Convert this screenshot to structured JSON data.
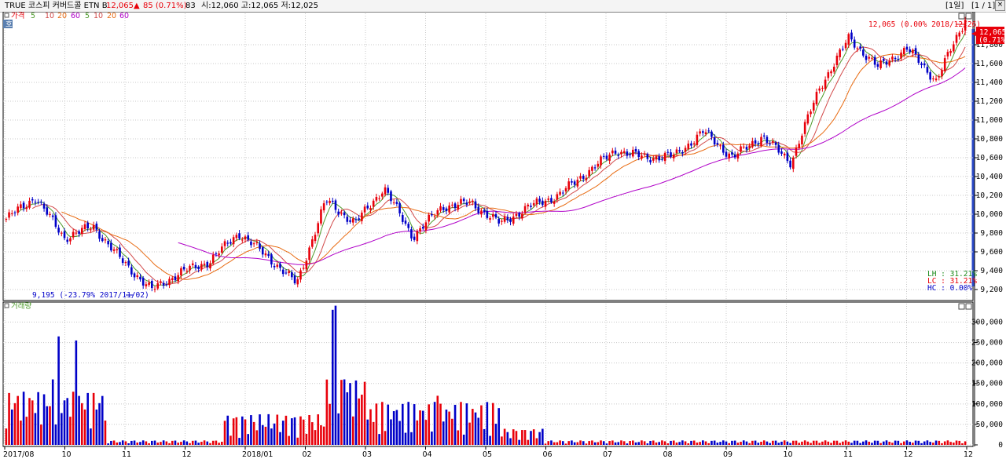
{
  "header": {
    "title": "TRUE 코스피 커버드콜 ETN B",
    "price": "12,065",
    "change_arrow": "▲",
    "change": "85 (0.71%)",
    "code": "83",
    "ohlc": "시:12,060 고:12,065 저:12,025",
    "period": "[1일]",
    "page": "[1 / 1]"
  },
  "legend": {
    "price_label": "가격",
    "ma_labels": [
      "5",
      "10",
      "20",
      "60"
    ],
    "ma_labels_b": [
      "5",
      "10",
      "20",
      "60"
    ],
    "volume_label": "거래량"
  },
  "annotations": {
    "last_price": "12,065",
    "last_change": "(0.71%)",
    "high_note": "12,065 (0.00% 2018/12/26)",
    "low_note": "9,195 (-23.79% 2017/11/02)",
    "lh": "LH : 31.21%",
    "lc": "LC : 31.21%",
    "hc": "HC :  0.00%"
  },
  "colors": {
    "up": "#e8000a",
    "down": "#0000c8",
    "ma5": "#4c9a2a",
    "ma10": "#d24a4a",
    "ma20": "#e86a10",
    "ma60": "#b000c8",
    "grid": "#c8c8c8",
    "axis": "#000000"
  },
  "chart_data": [
    {
      "type": "candlestick",
      "title": "가격",
      "x_ticks": [
        "2017/08",
        "10",
        "11",
        "12",
        "2018/01",
        "02",
        "03",
        "04",
        "05",
        "06",
        "07",
        "08",
        "09",
        "10",
        "11",
        "12",
        "12"
      ],
      "y_ticks": [
        "9,200",
        "9,400",
        "9,600",
        "9,800",
        "10,000",
        "10,200",
        "10,400",
        "10,600",
        "10,800",
        "11,000",
        "11,200",
        "11,400",
        "11,600",
        "11,800"
      ],
      "ylim": [
        9100,
        12100
      ],
      "series_close_anchors": [
        {
          "date": "2017/08",
          "close": 9950
        },
        {
          "date": "2017/08 end",
          "close": 10180
        },
        {
          "date": "2017/09 mid",
          "close": 9750
        },
        {
          "date": "2017/10",
          "close": 9870
        },
        {
          "date": "2017/10 mid",
          "close": 9500
        },
        {
          "date": "2017/11/02",
          "close": 9195
        },
        {
          "date": "2017/11 end",
          "close": 9380
        },
        {
          "date": "2017/12",
          "close": 9500
        },
        {
          "date": "2017/12 end",
          "close": 9800
        },
        {
          "date": "2018/01",
          "close": 9550
        },
        {
          "date": "2018/01 end",
          "close": 9260
        },
        {
          "date": "2018/02",
          "close": 10150
        },
        {
          "date": "2018/02 mid",
          "close": 9900
        },
        {
          "date": "2018/03",
          "close": 10280
        },
        {
          "date": "2018/03 mid",
          "close": 9760
        },
        {
          "date": "2018/04",
          "close": 10080
        },
        {
          "date": "2018/04 mid",
          "close": 10120
        },
        {
          "date": "2018/05",
          "close": 9900
        },
        {
          "date": "2018/05 mid",
          "close": 10080
        },
        {
          "date": "2018/06",
          "close": 10200
        },
        {
          "date": "2018/06 end",
          "close": 10450
        },
        {
          "date": "2018/07",
          "close": 10680
        },
        {
          "date": "2018/07 end",
          "close": 10600
        },
        {
          "date": "2018/08",
          "close": 10620
        },
        {
          "date": "2018/08 mid",
          "close": 10880
        },
        {
          "date": "2018/09",
          "close": 10600
        },
        {
          "date": "2018/09 mid",
          "close": 10830
        },
        {
          "date": "2018/10",
          "close": 10550
        },
        {
          "date": "2018/10 mid",
          "close": 11350
        },
        {
          "date": "2018/11",
          "close": 11870
        },
        {
          "date": "2018/11 mid",
          "close": 11560
        },
        {
          "date": "2018/12",
          "close": 11760
        },
        {
          "date": "2018/12 mid",
          "close": 11420
        },
        {
          "date": "2018/12/26",
          "close": 12065
        }
      ]
    },
    {
      "type": "bar",
      "title": "거래량",
      "y_ticks": [
        "0",
        "50,000",
        "100,000",
        "150,000",
        "200,000",
        "250,000",
        "300,000"
      ],
      "ylim": [
        0,
        345000
      ],
      "peaks": [
        {
          "date": "2017/09",
          "value": 265000
        },
        {
          "date": "2017/09 mid",
          "value": 255000
        },
        {
          "date": "2017/08 end",
          "value": 160000
        },
        {
          "date": "2018/02",
          "value": 330000
        },
        {
          "date": "2018/02 a",
          "value": 340000
        },
        {
          "date": "2018/02 b",
          "value": 160000
        },
        {
          "date": "2018/04 mid",
          "value": 120000
        },
        {
          "date": "2017/10",
          "value": 115000
        }
      ]
    }
  ]
}
